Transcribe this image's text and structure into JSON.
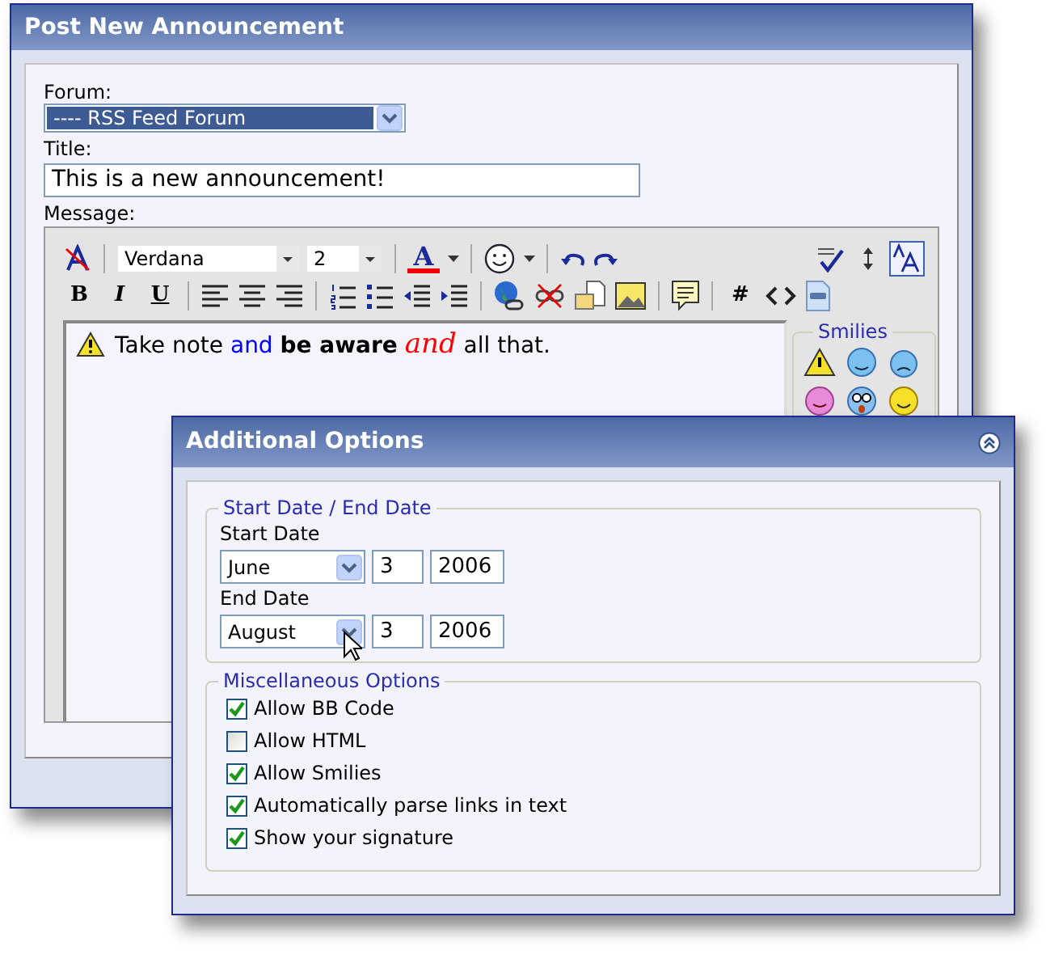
{
  "post_window": {
    "title": "Post New Announcement",
    "forum": {
      "label": "Forum:",
      "value": "---- RSS Feed Forum"
    },
    "title_field": {
      "label": "Title:",
      "value": "This is a new announcement!"
    },
    "message": {
      "label": "Message:",
      "toolbar": {
        "font": "Verdana",
        "size": "2",
        "color_glyph": "A",
        "format_buttons": [
          "B",
          "I",
          "U"
        ],
        "hash_glyph": "#"
      },
      "segments": [
        {
          "text": "Take note",
          "color": "#000000",
          "bold": false,
          "italic": false
        },
        {
          "text": "and",
          "color": "#0000ff",
          "bold": false,
          "italic": false
        },
        {
          "text": "be aware",
          "color": "#000000",
          "bold": true,
          "italic": false
        },
        {
          "text": "and",
          "color": "#ff0000",
          "bold": false,
          "italic": true
        },
        {
          "text": "all that.",
          "color": "#000000",
          "bold": false,
          "italic": false
        }
      ],
      "smilies_title": "Smilies"
    }
  },
  "options_window": {
    "title": "Additional Options",
    "date_group": {
      "legend": "Start Date / End Date",
      "dates": [
        {
          "label": "Start Date",
          "month": "June",
          "day": "3",
          "year": "2006"
        },
        {
          "label": "End Date",
          "month": "August",
          "day": "3",
          "year": "2006"
        }
      ]
    },
    "misc_group": {
      "legend": "Miscellaneous Options",
      "options": [
        {
          "label": "Allow BB Code",
          "checked": true
        },
        {
          "label": "Allow HTML",
          "checked": false
        },
        {
          "label": "Allow Smilies",
          "checked": true
        },
        {
          "label": "Automatically parse links in text",
          "checked": true
        },
        {
          "label": "Show your signature",
          "checked": true
        }
      ]
    }
  }
}
